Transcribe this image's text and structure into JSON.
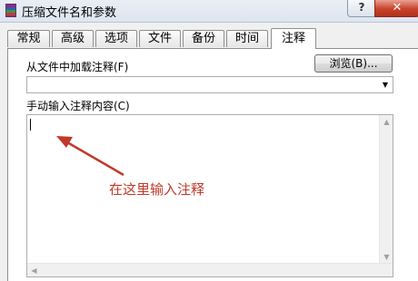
{
  "window": {
    "title": "压缩文件名和参数",
    "help_label": "?",
    "close_label": "✕"
  },
  "tabs": [
    {
      "label": "常规"
    },
    {
      "label": "高级"
    },
    {
      "label": "选项"
    },
    {
      "label": "文件"
    },
    {
      "label": "备份"
    },
    {
      "label": "时间"
    },
    {
      "label": "注释",
      "active": true
    }
  ],
  "comment_panel": {
    "load_label": "从文件中加载注释(F)",
    "browse_label": "浏览(B)...",
    "file_value": "",
    "manual_label": "手动输入注释内容(C)",
    "comment_text": ""
  },
  "annotation": {
    "text": "在这里输入注释",
    "color": "#c0392b"
  }
}
